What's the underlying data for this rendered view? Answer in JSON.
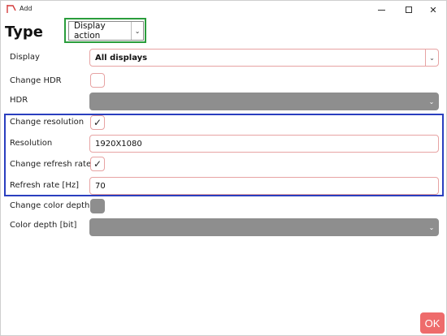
{
  "window": {
    "title": "Add",
    "icon": "app-logo-icon",
    "controls": {
      "minimize_icon": "minimize-icon",
      "maximize_icon": "maximize-icon",
      "close_icon": "close-icon",
      "close_glyph": "✕"
    }
  },
  "type": {
    "label": "Type",
    "selected": "Display action",
    "highlight_color": "#2a9d3c"
  },
  "form": {
    "display": {
      "label": "Display",
      "value": "All displays"
    },
    "change_hdr": {
      "label": "Change HDR",
      "checked": false
    },
    "hdr": {
      "label": "HDR",
      "value": "",
      "enabled": false
    },
    "change_resolution": {
      "label": "Change resolution",
      "checked": true,
      "mark": "✓"
    },
    "resolution": {
      "label": "Resolution",
      "value": "1920X1080"
    },
    "change_refresh_rate": {
      "label": "Change refresh rate",
      "checked": true,
      "mark": "✓"
    },
    "refresh_rate": {
      "label": "Refresh rate [Hz]",
      "value": "70"
    },
    "change_color_depth": {
      "label": "Change color depth",
      "checked": false,
      "enabled": false
    },
    "color_depth": {
      "label": "Color depth [bit]",
      "value": "",
      "enabled": false
    },
    "highlight_color": "#2a3fbf"
  },
  "ok_button": {
    "label": "OK",
    "color": "#ee6b6b"
  },
  "icons": {
    "chevron": "⌄"
  }
}
